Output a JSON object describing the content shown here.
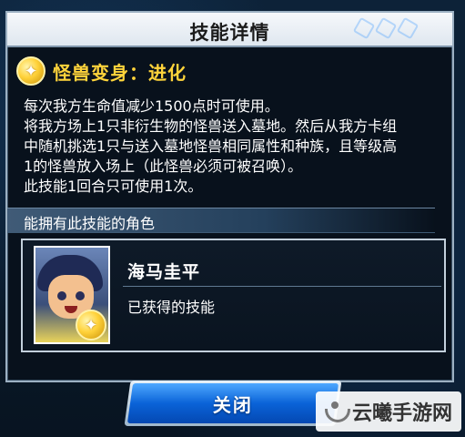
{
  "dialog": {
    "title": "技能详情",
    "skill_name": "怪兽变身：进化",
    "skill_icon": "sparkle-star-icon",
    "description": [
      "每次我方生命值减少1500点时可使用。",
      "将我方场上1只非衍生物的怪兽送入墓地。然后从我方卡组",
      "中随机挑选1只与送入墓地怪兽相同属性和种族，且等级高",
      "1的怪兽放入场上（此怪兽必须可被召唤）。",
      "此技能1回合只可使用1次。"
    ],
    "section_title": "能拥有此技能的角色",
    "character": {
      "name": "海马圭平",
      "status": "已获得的技能"
    },
    "close_label": "关闭"
  },
  "watermark": {
    "text": "云曦手游网"
  },
  "colors": {
    "skill_name": "#ffd43b",
    "close_button": "#0a63d8"
  }
}
